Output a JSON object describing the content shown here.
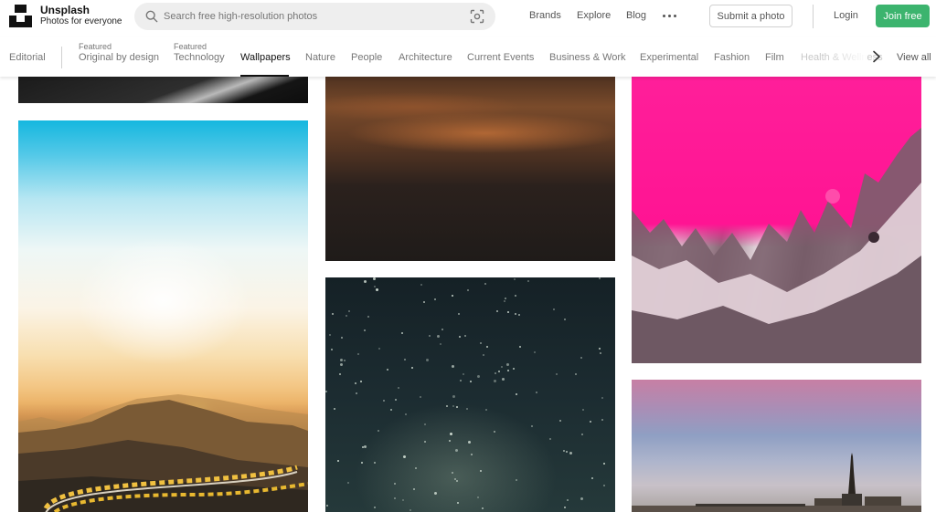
{
  "brand": {
    "name": "Unsplash",
    "tagline": "Photos for everyone"
  },
  "search": {
    "placeholder": "Search free high-resolution photos",
    "value": ""
  },
  "header_nav": {
    "brands": "Brands",
    "explore": "Explore",
    "blog": "Blog",
    "submit": "Submit a photo",
    "login": "Login",
    "join": "Join free"
  },
  "topics": {
    "editorial": "Editorial",
    "featured_label": "Featured",
    "original_by_design": "Original by design",
    "technology": "Technology",
    "wallpapers": "Wallpapers",
    "nature": "Nature",
    "people": "People",
    "architecture": "Architecture",
    "current_events": "Current Events",
    "business_work": "Business & Work",
    "experimental": "Experimental",
    "fashion": "Fashion",
    "film": "Film",
    "health": "Health & Wellness",
    "view_all": "View all",
    "active": "Wallpapers"
  },
  "colors": {
    "join_button": "#3cb46e",
    "active_topic": "#111111",
    "inactive_topic": "#767676"
  },
  "photos": [
    {
      "name": "dark-abstract-photo"
    },
    {
      "name": "desert-road-sunrise-photo"
    },
    {
      "name": "orange-clouds-photo"
    },
    {
      "name": "starry-night-sky-photo"
    },
    {
      "name": "pink-liquid-abstract-photo"
    },
    {
      "name": "seaside-tower-sunset-photo"
    }
  ]
}
